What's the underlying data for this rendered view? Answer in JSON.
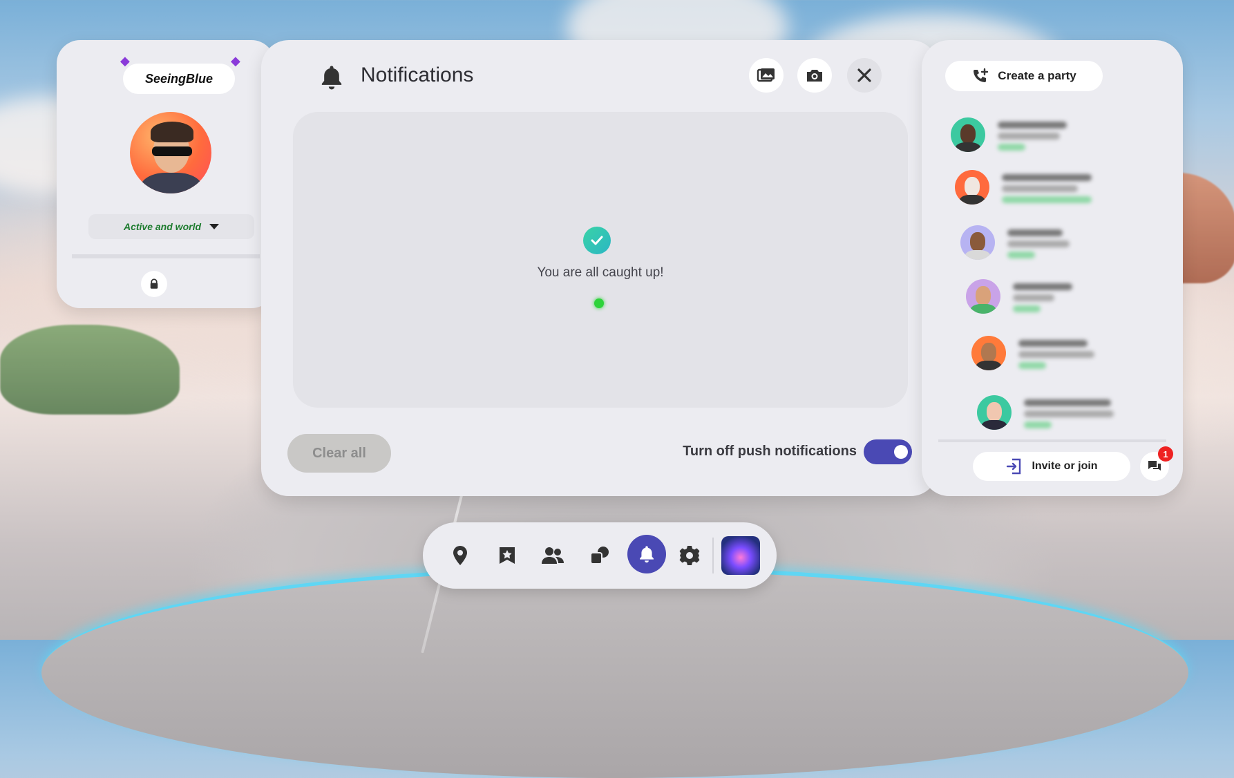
{
  "profile": {
    "username": "SeeingBlue",
    "status": "Active and world"
  },
  "notifications": {
    "title": "Notifications",
    "empty_message": "You are all caught up!",
    "clear_all": "Clear all",
    "push_label": "Turn off push notifications",
    "push_enabled": true
  },
  "party": {
    "create_label": "Create a party",
    "invite_label": "Invite or join",
    "chat_badge": "1",
    "friends_count_visible": 6
  },
  "dock": {
    "items": [
      "location-icon",
      "star-bookmark-icon",
      "people-icon",
      "shapes-icon",
      "bell-icon",
      "gear-icon",
      "app-thumbnail"
    ],
    "active": "bell-icon"
  },
  "colors": {
    "accent": "#4a49b4",
    "status_green": "#1e7c2f",
    "badge_red": "#e22222"
  }
}
